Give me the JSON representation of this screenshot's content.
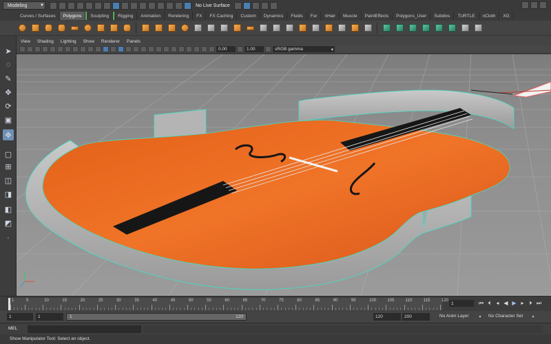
{
  "status_line": {
    "mode": "Modeling",
    "live_surface": "No Live Surface"
  },
  "shelf": {
    "tabs": [
      "Curves / Surfaces",
      "Polygons",
      "Sculpting",
      "Rigging",
      "Animation",
      "Rendering",
      "FX",
      "FX Caching",
      "Custom",
      "Dynamics",
      "Fluids",
      "Fur",
      "nHair",
      "Muscle",
      "PaintEffects",
      "Polygons_User",
      "Subdivs",
      "TURTLE",
      "nCloth",
      "XG"
    ],
    "active_tab": "Polygons"
  },
  "panel_menu": [
    "View",
    "Shading",
    "Lighting",
    "Show",
    "Renderer",
    "Panels"
  ],
  "panel_toolbar": {
    "exposure": "0.00",
    "gamma": "1.00",
    "color_space": "sRGB gamma"
  },
  "time_slider": {
    "ticks": [
      "1",
      "5",
      "10",
      "15",
      "20",
      "25",
      "30",
      "35",
      "40",
      "45",
      "50",
      "55",
      "60",
      "65",
      "70",
      "75",
      "80",
      "85",
      "90",
      "95",
      "100",
      "105",
      "110",
      "115",
      "120"
    ],
    "current_frame": "1"
  },
  "range_slider": {
    "start": "1",
    "playback_start": "1",
    "range_start_label": "1",
    "range_end_label": "120",
    "playback_end": "120",
    "end": "200",
    "anim_layer": "No Anim Layer",
    "character_set": "No Character Set"
  },
  "command_line": {
    "language": "MEL"
  },
  "help_line": {
    "text": "Show Manipulator Tool: Select an object."
  },
  "icons": {
    "select_tool": "arrow-icon",
    "play": "play-icon"
  },
  "colors": {
    "violin_body": "#e8661c",
    "violin_rib": "#a8a8a8",
    "wire_highlight": "#3fe0c8",
    "active_blue": "#6f8fb5"
  }
}
